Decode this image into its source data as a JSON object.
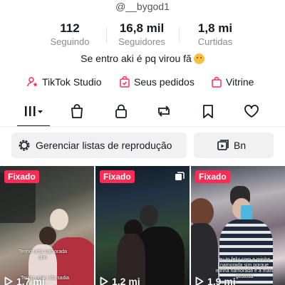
{
  "profile": {
    "username": "@__bygod1",
    "bio": "Se entro aki é pq virou fã",
    "emoji_icon": "pleading-face-emoji"
  },
  "stats": [
    {
      "value": "112",
      "label": "Seguindo"
    },
    {
      "value": "16,8 mil",
      "label": "Seguidores"
    },
    {
      "value": "1,8 mi",
      "label": "Curtidas"
    }
  ],
  "links": [
    {
      "label": "TikTok Studio",
      "icon": "person-star-icon"
    },
    {
      "label": "Seus pedidos",
      "icon": "order-bag-icon"
    },
    {
      "label": "Vitrine",
      "icon": "shopping-bag-icon"
    }
  ],
  "tabs": [
    {
      "icon": "grid-dropdown-icon",
      "active": true
    },
    {
      "icon": "shop-bag-icon"
    },
    {
      "icon": "lock-icon"
    },
    {
      "icon": "repost-icon"
    },
    {
      "icon": "bookmark-icon"
    },
    {
      "icon": "heart-icon"
    }
  ],
  "actions": {
    "playlists_label": "Gerenciar listas de reprodução",
    "second_label": "Bn"
  },
  "videos": [
    {
      "badge": "Fixado",
      "views": "1,7 mi",
      "caption_1": "Tenho uma namorada que",
      "caption_2": "Tenho uma vida sadia"
    },
    {
      "badge": "Fixado",
      "views": "1,2 mi",
      "multi_icon": "multi-photo-icon"
    },
    {
      "badge": "Fixado",
      "views": "1,9 mi",
      "caption_1": "eu to feliz com a minha namorada sim porque",
      "caption_2": "minha namorada é a mais gostosa"
    }
  ],
  "colors": {
    "accent": "#fe2c55",
    "text": "#161823",
    "muted": "#8a8b91",
    "pill_bg": "#f1f1f2"
  }
}
